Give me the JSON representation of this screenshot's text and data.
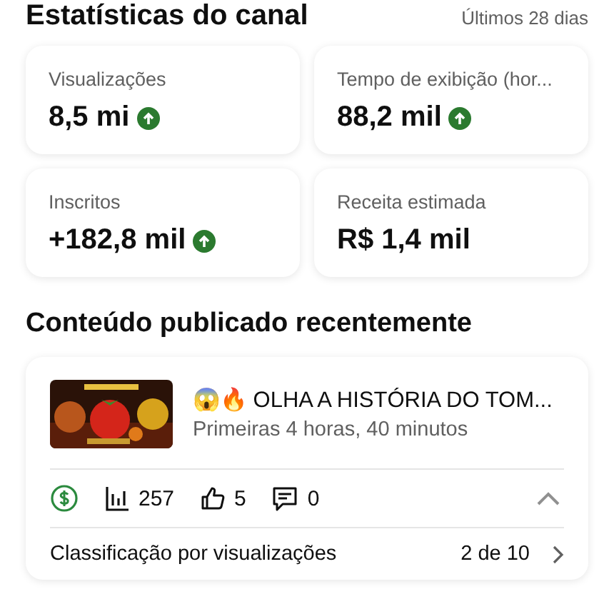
{
  "header": {
    "title": "Estatísticas do canal",
    "period": "Últimos 28 dias"
  },
  "stats": [
    {
      "label": "Visualizações",
      "value": "8,5 mi",
      "trending_up": true
    },
    {
      "label": "Tempo de exibição (hor...",
      "value": "88,2 mil",
      "trending_up": true
    },
    {
      "label": "Inscritos",
      "value": "+182,8 mil",
      "trending_up": true
    },
    {
      "label": "Receita estimada",
      "value": "R$ 1,4 mil",
      "trending_up": false
    }
  ],
  "recent": {
    "title": "Conteúdo publicado recentemente",
    "video": {
      "title": "😱🔥 OLHA A HISTÓRIA DO TOM...",
      "subtitle": "Primeiras 4 horas, 40 minutos",
      "monetized": true,
      "views": "257",
      "likes": "5",
      "comments": "0",
      "expanded": true
    },
    "ranking": {
      "label": "Classificação por visualizações",
      "value": "2 de 10"
    }
  }
}
